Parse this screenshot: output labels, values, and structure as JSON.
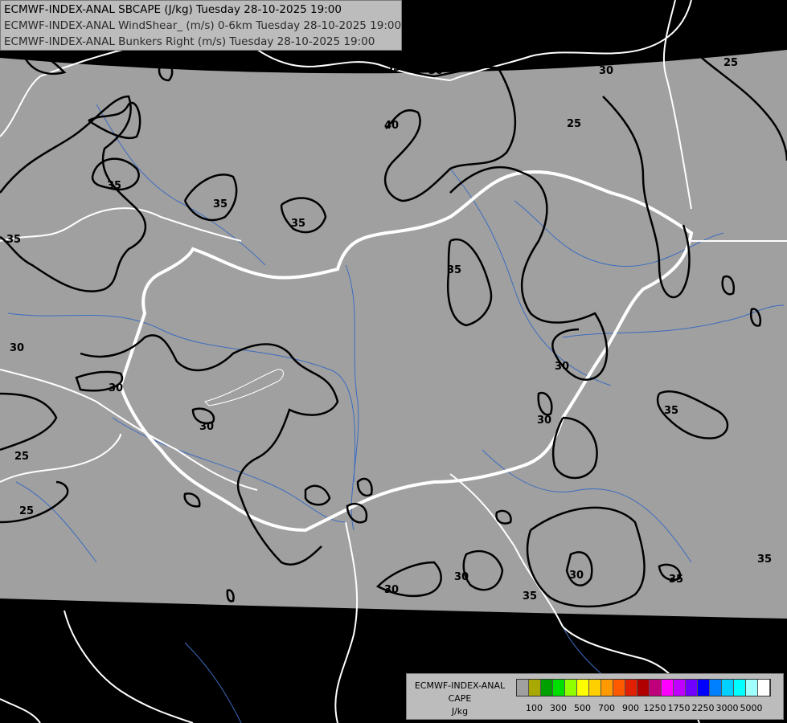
{
  "header": {
    "line1": "ECMWF-INDEX-ANAL SBCAPE (J/kg) Tuesday 28-10-2025 19:00",
    "line2": "ECMWF-INDEX-ANAL WindShear_ (m/s) 0-6km Tuesday 28-10-2025 19:00",
    "line3": "ECMWF-INDEX-ANAL Bunkers Right (m/s) Tuesday 28-10-2025 19:00"
  },
  "legend": {
    "title1": "ECMWF-INDEX-ANAL",
    "title2": "CAPE",
    "title3": "J/kg",
    "colors": [
      "#a0a0a0",
      "#a8a800",
      "#00a000",
      "#00e000",
      "#90ff00",
      "#ffff00",
      "#ffd000",
      "#ff9a00",
      "#ff5a00",
      "#e02000",
      "#b00000",
      "#c0007a",
      "#ff00ff",
      "#c000ff",
      "#7000ff",
      "#0000ff",
      "#0080ff",
      "#00d0ff",
      "#00ffff",
      "#a0ffff",
      "#ffffff"
    ],
    "labels": [
      "100",
      "300",
      "500",
      "700",
      "900",
      "1250",
      "1750",
      "2250",
      "3000",
      "5000"
    ]
  },
  "contour_labels": [
    "35",
    "30",
    "25",
    "40",
    "25",
    "30",
    "35",
    "35",
    "35",
    "35",
    "35",
    "35",
    "30",
    "30",
    "30",
    "25",
    "25",
    "30",
    "30",
    "35",
    "30",
    "30",
    "35",
    "30",
    "35"
  ]
}
